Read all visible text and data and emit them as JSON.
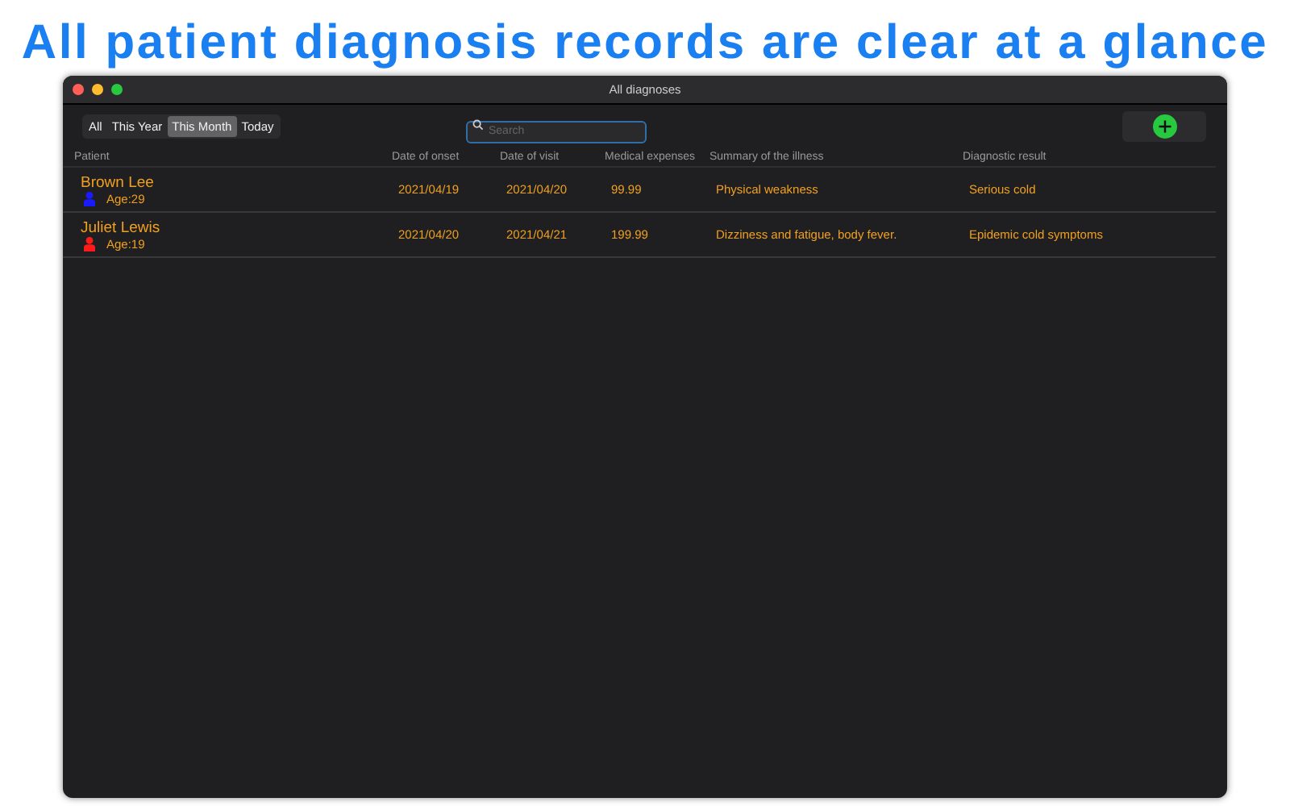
{
  "headline": "All patient diagnosis records are clear at a glance",
  "window": {
    "title": "All diagnoses"
  },
  "filters": [
    {
      "label": "All",
      "selected": false
    },
    {
      "label": "This Year",
      "selected": false
    },
    {
      "label": "This Month",
      "selected": true
    },
    {
      "label": "Today",
      "selected": false
    }
  ],
  "search": {
    "placeholder": "Search"
  },
  "table": {
    "columns": [
      "Patient",
      "Date of onset",
      "Date of visit",
      "Medical expenses",
      "Summary of the illness",
      "Diagnostic result"
    ],
    "rows": [
      {
        "name": "Brown Lee",
        "age": "Age:29",
        "color": "#1a1aff",
        "onset": "2021/04/19",
        "visit": "2021/04/20",
        "expenses": "99.99",
        "summary": "Physical weakness",
        "result": "Serious cold"
      },
      {
        "name": "Juliet Lewis",
        "age": "Age:19",
        "color": "#ff1a1a",
        "onset": "2021/04/20",
        "visit": "2021/04/21",
        "expenses": "199.99",
        "summary": "Dizziness and fatigue, body fever.",
        "result": "Epidemic cold symptoms"
      }
    ]
  }
}
